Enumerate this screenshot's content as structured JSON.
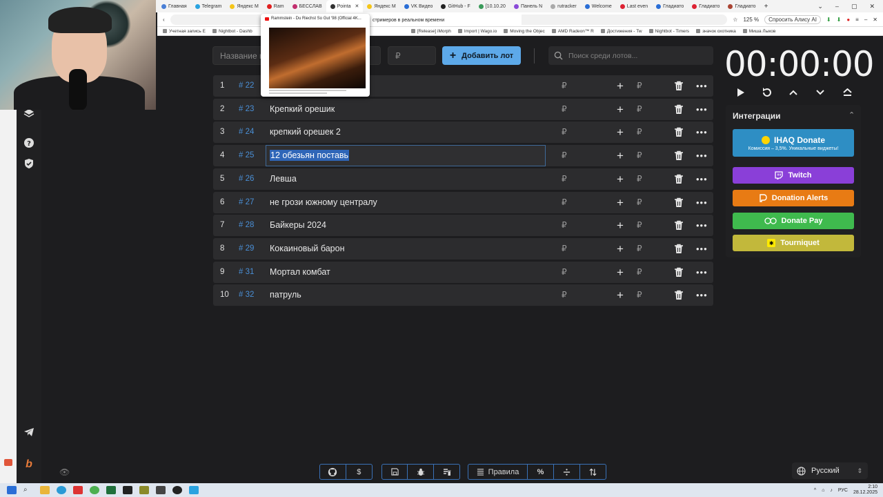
{
  "browser": {
    "tabs": [
      "Главная",
      "Telegram",
      "Яндекс М",
      "Ram",
      "БЕССЛАВ",
      "Pointa",
      "Яндекс М",
      "VK Видео",
      "GitHub - F",
      "[10.10.20",
      "Панель N",
      "rutracker",
      "Welcome",
      "Last even",
      "Гладиато",
      "Гладиато",
      "Гладиато"
    ],
    "zoom": "125 %",
    "alice": "Спросить Алису AI",
    "address_hint": "стримеров в реальном времени",
    "bookmarks": [
      "Учетная запись E",
      "Nightbot - Dashb",
      "[Release] iMorph",
      "Import | Wago.io",
      "Moving the Objec",
      "AMD Radeon™ R",
      "Достижения - Tw",
      "Nightbot - Timers",
      "значок охотника",
      "Миша Лыков"
    ]
  },
  "preview": {
    "title": "Rammstein - Du Riechst So Gut '98 (Official 4K..."
  },
  "topbar": {
    "name_placeholder": "Название н",
    "amount_placeholder": "₽",
    "add_button": "Добавить лот",
    "search_placeholder": "Поиск среди лотов..."
  },
  "lots": [
    {
      "num": "1",
      "id": "# 22",
      "name": ""
    },
    {
      "num": "2",
      "id": "# 23",
      "name": "Крепкий орешик"
    },
    {
      "num": "3",
      "id": "# 24",
      "name": " крепкий орешек 2"
    },
    {
      "num": "4",
      "id": "# 25",
      "name": "12 обезьян поставь"
    },
    {
      "num": "5",
      "id": "# 26",
      "name": "Левша"
    },
    {
      "num": "6",
      "id": "# 27",
      "name": "не грози южному централу"
    },
    {
      "num": "7",
      "id": "# 28",
      "name": "Байкеры 2024"
    },
    {
      "num": "8",
      "id": "# 29",
      "name": "Кокаиновый барон"
    },
    {
      "num": "9",
      "id": "# 31",
      "name": "Мортал комбат"
    },
    {
      "num": "10",
      "id": "# 32",
      "name": "патруль"
    }
  ],
  "row_common": {
    "currency": "₽",
    "plus": "+",
    "more": "•••"
  },
  "timer": {
    "value": "00:00:00"
  },
  "integrations": {
    "title": "Интеграции",
    "ihaq_title": "IHAQ Donate",
    "ihaq_sub": "Комиссия – 3,5%. Уникальные виджеты!",
    "twitch": "Twitch",
    "donation_alerts": "Donation Alerts",
    "donate_pay": "Donate Pay",
    "tourniquet": "Tourniquet"
  },
  "bottom": {
    "rules": "Правила",
    "percent": "%",
    "dollar": "$"
  },
  "language": "Русский",
  "taskbar": {
    "lang": "РУС",
    "time": "2:10",
    "date": "28.12.2025"
  },
  "colors": {
    "accent": "#5da9e9",
    "id_blue": "#4a8fd6",
    "twitch": "#8a3fd8",
    "donation_alerts": "#e87b14",
    "donate_pay": "#3fba4e",
    "tourniquet": "#c2b83b",
    "ihaq": "#2e8ec4"
  }
}
